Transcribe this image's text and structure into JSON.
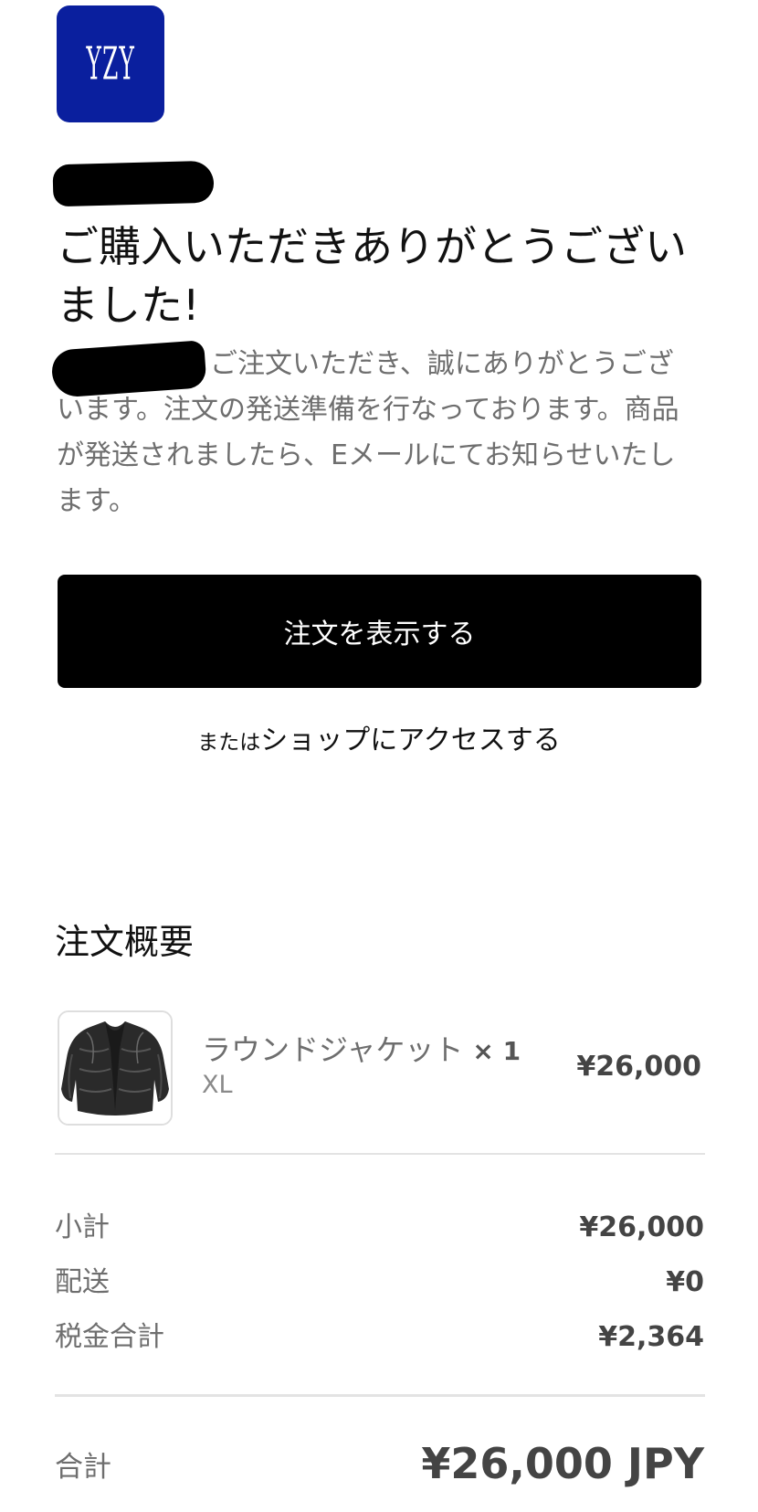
{
  "brand": {
    "logo_text": "YZY",
    "logo_color": "#0a1f9e"
  },
  "confirmation": {
    "heading": "ご購入いただきありがとうございました!",
    "message": "ご注文いただき、誠にありがとうございます。注文の発送準備を行なっております。商品が発送されましたら、Eメールにてお知らせいたします。"
  },
  "actions": {
    "view_order_label": "注文を表示する",
    "shop_prefix": "または",
    "shop_link_label": "ショップにアクセスする"
  },
  "order_summary": {
    "title": "注文概要",
    "items": [
      {
        "name": "ラウンドジャケット",
        "quantity": "× 1",
        "variant": "XL",
        "price": "¥26,000",
        "thumbnail_icon": "black-puffer-jacket"
      }
    ],
    "subtotal_label": "小計",
    "subtotal_value": "¥26,000",
    "shipping_label": "配送",
    "shipping_value": "¥0",
    "taxes_label": "税金合計",
    "taxes_value": "¥2,364",
    "total_label": "合計",
    "total_value": "¥26,000 JPY"
  }
}
